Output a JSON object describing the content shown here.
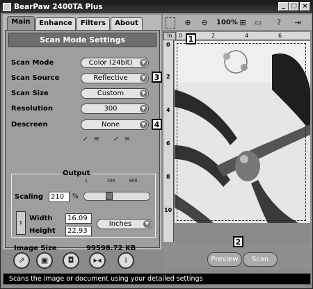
{
  "window": {
    "title": "BearPaw 2400TA Plus",
    "minimize": "_",
    "maximize": "□",
    "close": "×"
  },
  "tabs": [
    {
      "label": "Main",
      "active": true
    },
    {
      "label": "Enhance",
      "active": false
    },
    {
      "label": "Filters",
      "active": false
    },
    {
      "label": "About",
      "active": false
    }
  ],
  "section": {
    "title": "Scan Mode Settings"
  },
  "settings": [
    {
      "label": "Scan Mode",
      "value": "Color (24bit)"
    },
    {
      "label": "Scan Source",
      "value": "Reflective"
    },
    {
      "label": "Scan Size",
      "value": "Custom"
    },
    {
      "label": "Resolution",
      "value": "300"
    },
    {
      "label": "Descreen",
      "value": "None"
    }
  ],
  "callouts": {
    "c1": "1",
    "c2": "2",
    "c3": "3",
    "c4": "4"
  },
  "output": {
    "title": "Output",
    "scaling_label": "Scaling",
    "scaling_value": "210",
    "scaling_unit": "%",
    "ticks": [
      "1",
      "300",
      "600"
    ],
    "width_label": "Width",
    "width_value": "16.09",
    "height_label": "Height",
    "height_value": "22.93",
    "units": "Inches"
  },
  "image_size": {
    "label": "Image Size",
    "value": "99598.72 KB"
  },
  "preview_toolbar": {
    "zoom": "100%"
  },
  "ruler": {
    "unit": "In",
    "h_ticks": [
      "0",
      "2",
      "4",
      "6"
    ],
    "v_ticks": [
      "0",
      "2",
      "4",
      "6",
      "8",
      "10"
    ]
  },
  "buttons": {
    "preview": "Preview",
    "scan": "Scan"
  },
  "status": "Scans the image or document using your detailed settings",
  "colors": {
    "titlebar": "#1a1a1a",
    "panel": "#9e9e9e",
    "status_bg": "#000000"
  }
}
